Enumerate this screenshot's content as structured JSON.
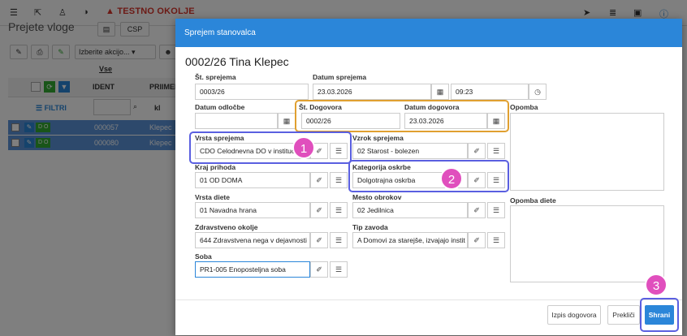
{
  "topbar": {
    "warning": "▲ TESTNO OKOLJE"
  },
  "page": {
    "title": "Prejete vloge",
    "csp_label": "CSP",
    "action_select": "Izberite akcijo...",
    "vse_label": "Vse",
    "col_ident": "IDENT",
    "col_priimek": "PRIIMEK",
    "filter_label": "☰ FILTRI",
    "kl_label": "kl",
    "rows": [
      {
        "badge": "D O",
        "ident": "000057",
        "priimek": "Klepec"
      },
      {
        "badge": "D O",
        "ident": "000080",
        "priimek": "Klepec"
      }
    ]
  },
  "modal": {
    "header": "Sprejem stanovalca",
    "title": "0002/26 Tina Klepec",
    "fields": {
      "st_sprejema": {
        "label": "Št. sprejema",
        "value": "0003/26"
      },
      "datum_sprejema": {
        "label": "Datum sprejema",
        "value": "23.03.2026",
        "time": "09:23"
      },
      "datum_odlocbe": {
        "label": "Datum odločbe",
        "value": ""
      },
      "st_dogovora": {
        "label": "Št. Dogovora",
        "value": "0002/26"
      },
      "datum_dogovora": {
        "label": "Datum dogovora",
        "value": "23.03.2026"
      },
      "opomba": {
        "label": "Opomba"
      },
      "vrsta_sprejema": {
        "label": "Vrsta sprejema",
        "value": "CDO Celodnevna DO v institucij"
      },
      "vzrok_sprejema": {
        "label": "Vzrok sprejema",
        "value": "02 Starost - bolezen"
      },
      "kraj_prihoda": {
        "label": "Kraj prihoda",
        "value": "01 OD DOMA"
      },
      "kategorija_oskrbe": {
        "label": "Kategorija oskrbe",
        "value": "Dolgotrajna oskrba"
      },
      "vrsta_diete": {
        "label": "Vrsta diete",
        "value": "01 Navadna hrana"
      },
      "mesto_obrokov": {
        "label": "Mesto obrokov",
        "value": "02 Jedilnica"
      },
      "opomba_diete": {
        "label": "Opomba diete"
      },
      "zdravstveno_okolje": {
        "label": "Zdravstveno okolje",
        "value": "644 Zdravstvena nega v dejavnosti"
      },
      "tip_zavoda": {
        "label": "Tip zavoda",
        "value": "A Domovi za starejše, izvajajo instit"
      },
      "soba": {
        "label": "Soba",
        "value": "PR1-005 Enoposteljna soba"
      }
    },
    "buttons": {
      "izpis": "Izpis dogovora",
      "preklici": "Prekliči",
      "shrani": "Shrani"
    },
    "badges": [
      "1",
      "2",
      "3"
    ]
  },
  "colors": {
    "accent": "#2b86d9",
    "badge": "#e04fbd",
    "highlight_orange": "#e0a030",
    "highlight_blue": "#5a5fe0",
    "warning": "#d9342b"
  }
}
